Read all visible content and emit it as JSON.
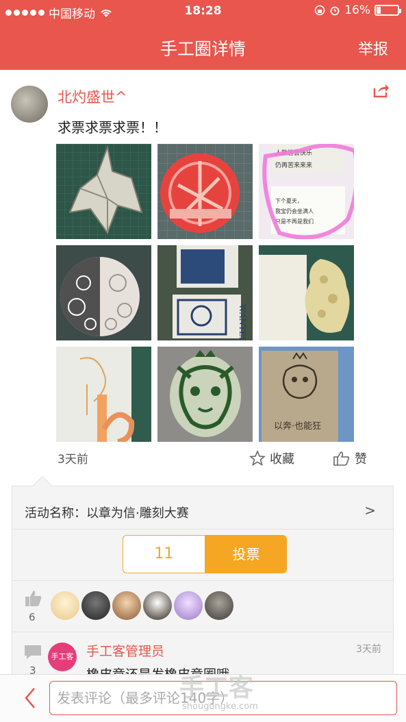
{
  "statusbar": {
    "carrier": "中国移动",
    "time": "18:28",
    "battery": "16%"
  },
  "navbar": {
    "title": "手工圈详情",
    "report": "举报"
  },
  "post": {
    "username": "北灼盛世^",
    "text": "求票求票求票！！",
    "time": "3天前",
    "favorite_label": "收藏",
    "like_label": "赞",
    "images": [
      "crane-stamp",
      "round-seal-stamp",
      "calligraphy-stamp",
      "lace-circle-stamp",
      "wanted-poster-stamps",
      "floral-stamp",
      "sketch-stamp",
      "cat-stamp",
      "cat-print"
    ],
    "image_texts": {
      "calligraphy_top": "人散皆会快乐\n仍再苦来来来",
      "calligraphy_bottom": "下个夏天，\n我宝仍会坐满人\n只是不再是我们",
      "wanted": "WANTED",
      "cat_print": "以奔·也能狂"
    }
  },
  "activity": {
    "label": "活动名称：以章为信·雕刻大赛",
    "arrow": ">",
    "vote_count": "11",
    "vote_button": "投票"
  },
  "likes": {
    "count": "6"
  },
  "comments": {
    "count": "3",
    "author": "手工客管理员",
    "time": "3天前",
    "text": "橡皮章还是发橡皮章圈哦",
    "avatar_text": "手工客"
  },
  "input": {
    "placeholder": "发表评论（最多评论140字）"
  },
  "watermark": {
    "main": "手工客",
    "sub": "shougongke.com"
  },
  "colors": {
    "accent": "#e9564d",
    "vote": "#f5a623"
  }
}
